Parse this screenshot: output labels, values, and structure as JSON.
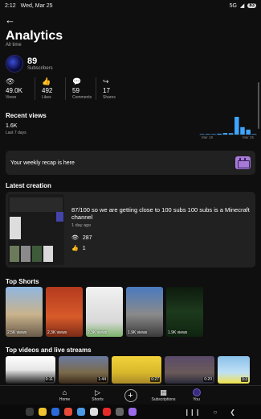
{
  "status_bar": {
    "time": "2:12",
    "date": "Wed, Mar 25",
    "network": "5G",
    "signal": "◢",
    "battery": "83"
  },
  "header": {
    "back_icon": "back-arrow-icon",
    "title": "Analytics",
    "subtitle": "All time"
  },
  "channel": {
    "subscribers": "89",
    "subscribers_label": "Subscribers"
  },
  "stats": [
    {
      "icon": "👁",
      "value": "49.0K",
      "label": "Views"
    },
    {
      "icon": "👍",
      "value": "492",
      "label": "Likes"
    },
    {
      "icon": "💬",
      "value": "59",
      "label": "Comments"
    },
    {
      "icon": "↪",
      "value": "17",
      "label": "Shares"
    }
  ],
  "recent_views": {
    "title": "Recent views",
    "value": "1.6K",
    "period": "Last 7 days",
    "axis_start": "Mar 18",
    "axis_end": "Mar 25",
    "accent": "#3ea6ff",
    "bars": [
      0.02,
      0.03,
      0.02,
      0.05,
      0.09,
      0.08,
      1.0,
      0.42,
      0.28,
      0.03
    ]
  },
  "recap": {
    "text": "Your weekly recap is here"
  },
  "latest": {
    "section_title": "Latest creation",
    "title": "87/100 so we are getting close to 100 subs 100 subs is a Minecraft channel",
    "time": "1 day ago",
    "views": "287",
    "likes": "1"
  },
  "shorts": {
    "section_title": "Top Shorts",
    "items": [
      {
        "views": "2.5K views"
      },
      {
        "views": "2.3K views"
      },
      {
        "views": "2.3K views"
      },
      {
        "views": "1.9K views"
      },
      {
        "views": "1.9K views"
      }
    ]
  },
  "videos": {
    "section_title": "Top videos and live streams",
    "items": [
      {
        "duration": "0:11"
      },
      {
        "duration": "1:44"
      },
      {
        "duration": "0:27"
      },
      {
        "duration": "0:20"
      },
      {
        "duration": "3:3"
      }
    ]
  },
  "nav": {
    "home": "Home",
    "shorts": "Shorts",
    "create": "+",
    "subscriptions": "Subscriptions",
    "you": "You"
  }
}
